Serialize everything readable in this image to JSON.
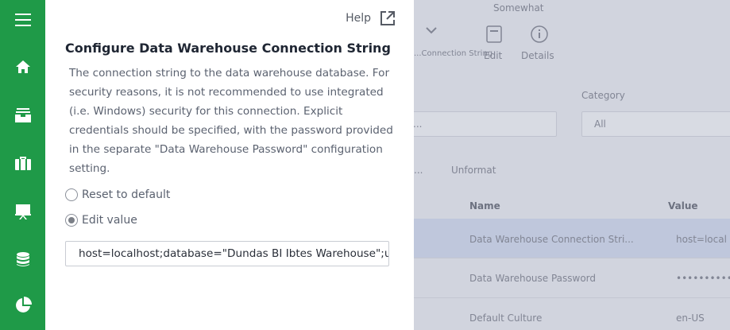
{
  "nav": {
    "items": [
      {
        "icon": "menu-icon"
      },
      {
        "icon": "home-icon"
      },
      {
        "icon": "inbox-icon"
      },
      {
        "icon": "briefcase-icon"
      },
      {
        "icon": "presentation-icon"
      },
      {
        "icon": "database-icon"
      },
      {
        "icon": "pie-chart-icon"
      }
    ]
  },
  "dialog": {
    "help_label": "Help",
    "title": "Configure Data Warehouse Connection String",
    "description": "The connection string to the data warehouse database. For security reasons, it is not recommended to use integrated (i.e. Windows) security for this connection. Explicit credentials should be specified, with the password provided in the separate \"Data Warehouse Password\" configuration setting.",
    "options": {
      "reset_label": "Reset to default",
      "edit_label": "Edit value",
      "selected": "edit"
    },
    "value": "host=localhost;database=\"Dundas BI Ibtes Warehouse\";u"
  },
  "background": {
    "toolbar": {
      "group_label": "Somewhat",
      "buttons": [
        "Edit",
        "Details"
      ],
      "partial_label": "...Connection String"
    },
    "category_label": "Category",
    "category_value": "All",
    "filter_value": "...",
    "filter_label": "Unformat",
    "table_headers": {
      "name": "Name",
      "value": "Value"
    },
    "rows": [
      {
        "name": "Data Warehouse Connection Stri...",
        "value": "host=local"
      },
      {
        "name": "Data Warehouse Password",
        "value": "••••••••••"
      },
      {
        "name": "Default Culture",
        "value": "en-US"
      }
    ]
  },
  "colors": {
    "rail": "#1f9a48",
    "panel": "#ffffff",
    "overlay": "#d9dbe3"
  }
}
